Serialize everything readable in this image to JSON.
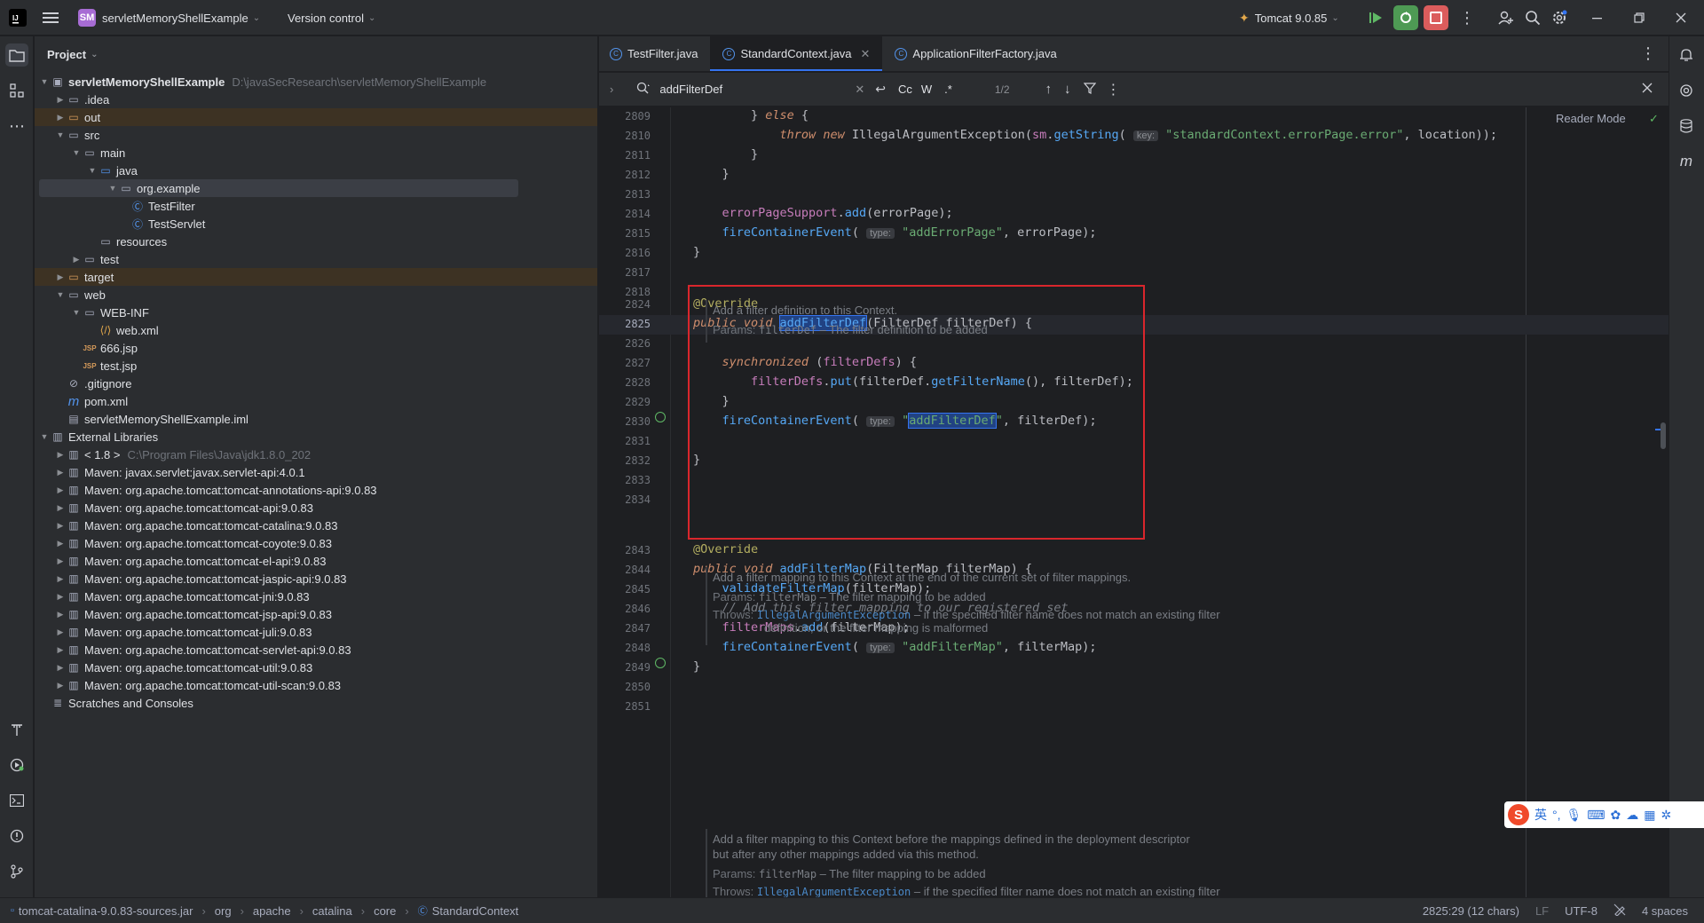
{
  "titlebar": {
    "project_badge": "SM",
    "project_name": "servletMemoryShellExample",
    "vcs": "Version control",
    "run_config": "Tomcat 9.0.85"
  },
  "project_panel": {
    "title": "Project",
    "tree": [
      {
        "label": "servletMemoryShellExample",
        "path": "D:\\javaSecResearch\\servletMemoryShellExample",
        "depth": 0,
        "arrow": "down",
        "icon": "module-folder-icon",
        "bold": true
      },
      {
        "label": ".idea",
        "depth": 1,
        "arrow": "right",
        "icon": "folder-icon"
      },
      {
        "label": "out",
        "depth": 1,
        "arrow": "right",
        "icon": "excluded-folder-icon",
        "excluded": true
      },
      {
        "label": "src",
        "depth": 1,
        "arrow": "down",
        "icon": "folder-icon"
      },
      {
        "label": "main",
        "depth": 2,
        "arrow": "down",
        "icon": "folder-icon"
      },
      {
        "label": "java",
        "depth": 3,
        "arrow": "down",
        "icon": "source-folder-icon"
      },
      {
        "label": "org.example",
        "depth": 4,
        "arrow": "down",
        "icon": "package-icon",
        "selected": true
      },
      {
        "label": "TestFilter",
        "depth": 5,
        "arrow": "",
        "icon": "class-icon"
      },
      {
        "label": "TestServlet",
        "depth": 5,
        "arrow": "",
        "icon": "class-icon"
      },
      {
        "label": "resources",
        "depth": 3,
        "arrow": "",
        "icon": "resources-folder-icon"
      },
      {
        "label": "test",
        "depth": 2,
        "arrow": "right",
        "icon": "folder-icon"
      },
      {
        "label": "target",
        "depth": 1,
        "arrow": "right",
        "icon": "excluded-folder-icon",
        "excluded": true
      },
      {
        "label": "web",
        "depth": 1,
        "arrow": "down",
        "icon": "folder-icon"
      },
      {
        "label": "WEB-INF",
        "depth": 2,
        "arrow": "down",
        "icon": "folder-icon"
      },
      {
        "label": "web.xml",
        "depth": 3,
        "arrow": "",
        "icon": "xml-file-icon"
      },
      {
        "label": "666.jsp",
        "depth": 2,
        "arrow": "",
        "icon": "jsp-file-icon"
      },
      {
        "label": "test.jsp",
        "depth": 2,
        "arrow": "",
        "icon": "jsp-file-icon"
      },
      {
        "label": ".gitignore",
        "depth": 1,
        "arrow": "",
        "icon": "gitignore-icon"
      },
      {
        "label": "pom.xml",
        "depth": 1,
        "arrow": "",
        "icon": "maven-icon"
      },
      {
        "label": "servletMemoryShellExample.iml",
        "depth": 1,
        "arrow": "",
        "icon": "iml-file-icon"
      },
      {
        "label": "External Libraries",
        "depth": 0,
        "arrow": "down",
        "icon": "library-icon"
      },
      {
        "label": "< 1.8 >",
        "path": "C:\\Program Files\\Java\\jdk1.8.0_202",
        "depth": 1,
        "arrow": "right",
        "icon": "library-icon"
      },
      {
        "label": "Maven: javax.servlet:javax.servlet-api:4.0.1",
        "depth": 1,
        "arrow": "right",
        "icon": "library-icon"
      },
      {
        "label": "Maven: org.apache.tomcat:tomcat-annotations-api:9.0.83",
        "depth": 1,
        "arrow": "right",
        "icon": "library-icon"
      },
      {
        "label": "Maven: org.apache.tomcat:tomcat-api:9.0.83",
        "depth": 1,
        "arrow": "right",
        "icon": "library-icon"
      },
      {
        "label": "Maven: org.apache.tomcat:tomcat-catalina:9.0.83",
        "depth": 1,
        "arrow": "right",
        "icon": "library-icon"
      },
      {
        "label": "Maven: org.apache.tomcat:tomcat-coyote:9.0.83",
        "depth": 1,
        "arrow": "right",
        "icon": "library-icon"
      },
      {
        "label": "Maven: org.apache.tomcat:tomcat-el-api:9.0.83",
        "depth": 1,
        "arrow": "right",
        "icon": "library-icon"
      },
      {
        "label": "Maven: org.apache.tomcat:tomcat-jaspic-api:9.0.83",
        "depth": 1,
        "arrow": "right",
        "icon": "library-icon"
      },
      {
        "label": "Maven: org.apache.tomcat:tomcat-jni:9.0.83",
        "depth": 1,
        "arrow": "right",
        "icon": "library-icon"
      },
      {
        "label": "Maven: org.apache.tomcat:tomcat-jsp-api:9.0.83",
        "depth": 1,
        "arrow": "right",
        "icon": "library-icon"
      },
      {
        "label": "Maven: org.apache.tomcat:tomcat-juli:9.0.83",
        "depth": 1,
        "arrow": "right",
        "icon": "library-icon"
      },
      {
        "label": "Maven: org.apache.tomcat:tomcat-servlet-api:9.0.83",
        "depth": 1,
        "arrow": "right",
        "icon": "library-icon"
      },
      {
        "label": "Maven: org.apache.tomcat:tomcat-util:9.0.83",
        "depth": 1,
        "arrow": "right",
        "icon": "library-icon"
      },
      {
        "label": "Maven: org.apache.tomcat:tomcat-util-scan:9.0.83",
        "depth": 1,
        "arrow": "right",
        "icon": "library-icon"
      },
      {
        "label": "Scratches and Consoles",
        "depth": 0,
        "arrow": "",
        "icon": "scratches-icon"
      }
    ]
  },
  "tabs": [
    {
      "label": "TestFilter.java",
      "active": false
    },
    {
      "label": "StandardContext.java",
      "active": true,
      "closable": true
    },
    {
      "label": "ApplicationFilterFactory.java",
      "active": false
    }
  ],
  "find": {
    "query": "addFilterDef",
    "match_case": "Cc",
    "words": "W",
    "regex": ".*",
    "count": "1/2"
  },
  "editor": {
    "reader_mode": "Reader Mode",
    "lines": [
      {
        "n": "2809",
        "code": [
          [
            "",
            "        } "
          ],
          [
            "kwi",
            "else"
          ],
          [
            "",
            " {"
          ]
        ]
      },
      {
        "n": "2810",
        "code": [
          [
            "",
            "            "
          ],
          [
            "kwi",
            "throw new "
          ],
          [
            "",
            "IllegalArgumentException("
          ],
          [
            "fld",
            "sm"
          ],
          [
            "",
            "."
          ],
          [
            "fn",
            "getString"
          ],
          [
            "",
            "( "
          ],
          [
            "hint",
            "key:"
          ],
          [
            "str",
            " \"standardContext.errorPage.error\""
          ],
          [
            "",
            ", location));"
          ]
        ]
      },
      {
        "n": "2811",
        "code": [
          [
            "",
            "        }"
          ]
        ]
      },
      {
        "n": "2812",
        "code": [
          [
            "",
            "    }"
          ]
        ]
      },
      {
        "n": "2813",
        "code": []
      },
      {
        "n": "2814",
        "code": [
          [
            "",
            "    "
          ],
          [
            "fld",
            "errorPageSupport"
          ],
          [
            "",
            "."
          ],
          [
            "fn",
            "add"
          ],
          [
            "",
            "(errorPage);"
          ]
        ]
      },
      {
        "n": "2815",
        "code": [
          [
            "",
            "    "
          ],
          [
            "fn",
            "fireContainerEvent"
          ],
          [
            "",
            "( "
          ],
          [
            "hint",
            "type:"
          ],
          [
            "str",
            " \"addErrorPage\""
          ],
          [
            "",
            ", errorPage);"
          ]
        ]
      },
      {
        "n": "2816",
        "code": [
          [
            "",
            "}"
          ]
        ]
      },
      {
        "n": "2817",
        "code": []
      },
      {
        "n": "2818",
        "code": []
      }
    ],
    "doc1": {
      "summary": "Add a filter definition to this Context.",
      "params_label": "Params:",
      "param": "filterDef",
      "param_desc": " – The filter definition to be added"
    },
    "lines2": [
      {
        "n": "2824",
        "code": [
          [
            "ann",
            "@Override"
          ]
        ]
      },
      {
        "n": "2825",
        "code": [
          [
            "kwi",
            "public void "
          ],
          [
            "hlfn",
            "addFilterDef"
          ],
          [
            "",
            "(FilterDef filterDef) {"
          ]
        ],
        "current": true
      },
      {
        "n": "2826",
        "code": []
      },
      {
        "n": "2827",
        "code": [
          [
            "",
            "    "
          ],
          [
            "kwi",
            "synchronized"
          ],
          [
            "",
            " ("
          ],
          [
            "fld",
            "filterDefs"
          ],
          [
            "",
            ") {"
          ]
        ]
      },
      {
        "n": "2828",
        "code": [
          [
            "",
            "        "
          ],
          [
            "fld",
            "filterDefs"
          ],
          [
            "",
            "."
          ],
          [
            "fn",
            "put"
          ],
          [
            "",
            "(filterDef."
          ],
          [
            "fn",
            "getFilterName"
          ],
          [
            "",
            "(), filterDef);"
          ]
        ]
      },
      {
        "n": "2829",
        "code": [
          [
            "",
            "    }"
          ]
        ]
      },
      {
        "n": "2830",
        "code": [
          [
            "",
            "    "
          ],
          [
            "fn",
            "fireContainerEvent"
          ],
          [
            "",
            "( "
          ],
          [
            "hint",
            "type:"
          ],
          [
            "str",
            " \""
          ],
          [
            "hlstr",
            "addFilterDef"
          ],
          [
            "str",
            "\""
          ],
          [
            "",
            ", filterDef);"
          ]
        ]
      },
      {
        "n": "2831",
        "code": []
      },
      {
        "n": "2832",
        "code": [
          [
            "",
            "}"
          ]
        ]
      },
      {
        "n": "2833",
        "code": []
      },
      {
        "n": "2834",
        "code": []
      }
    ],
    "doc2": {
      "summary": "Add a filter mapping to this Context at the end of the current set of filter mappings.",
      "params_label": "Params:",
      "param": "filterMap",
      "param_desc": " – The filter mapping to be added",
      "throws_label": "Throws:",
      "throws": "IllegalArgumentException",
      "throws_desc1": " – if the specified filter name does not match an existing filter",
      "throws_desc2": "definition, or the filter mapping is malformed"
    },
    "lines3": [
      {
        "n": "2843",
        "code": [
          [
            "ann",
            "@Override"
          ]
        ]
      },
      {
        "n": "2844",
        "code": [
          [
            "kwi",
            "public void "
          ],
          [
            "fn",
            "addFilterMap"
          ],
          [
            "",
            "(FilterMap filterMap) {"
          ]
        ]
      },
      {
        "n": "2845",
        "code": [
          [
            "",
            "    "
          ],
          [
            "fn",
            "validateFilterMap"
          ],
          [
            "",
            "(filterMap);"
          ]
        ]
      },
      {
        "n": "2846",
        "code": [
          [
            "",
            "    "
          ],
          [
            "cmt",
            "// Add this filter mapping to our registered set"
          ]
        ]
      },
      {
        "n": "2847",
        "code": [
          [
            "",
            "    "
          ],
          [
            "fld",
            "filterMaps"
          ],
          [
            "",
            "."
          ],
          [
            "fn",
            "add"
          ],
          [
            "",
            "(filterMap);"
          ]
        ]
      },
      {
        "n": "2848",
        "code": [
          [
            "",
            "    "
          ],
          [
            "fn",
            "fireContainerEvent"
          ],
          [
            "",
            "( "
          ],
          [
            "hint",
            "type:"
          ],
          [
            "str",
            " \"addFilterMap\""
          ],
          [
            "",
            ", filterMap);"
          ]
        ]
      },
      {
        "n": "2849",
        "code": [
          [
            "",
            "}"
          ]
        ]
      },
      {
        "n": "2850",
        "code": []
      },
      {
        "n": "2851",
        "code": []
      }
    ],
    "doc3": {
      "summary1": "Add a filter mapping to this Context before the mappings defined in the deployment descriptor",
      "summary2": "but after any other mappings added via this method.",
      "params_label": "Params:",
      "param": "filterMap",
      "param_desc": " – The filter mapping to be added",
      "throws_label": "Throws:",
      "throws": "IllegalArgumentException",
      "throws_desc1": " – if the specified filter name does not match an existing filter"
    }
  },
  "statusbar": {
    "crumbs": [
      "tomcat-catalina-9.0.83-sources.jar",
      "org",
      "apache",
      "catalina",
      "core",
      "StandardContext"
    ],
    "position": "2825:29 (12 chars)",
    "line_sep": "LF",
    "encoding": "UTF-8",
    "indent": "4 spaces"
  },
  "ime": {
    "lang": "英"
  },
  "colors": {
    "accent": "#3574f0",
    "highlight_box": "#d9262c",
    "run_green": "#4e9a54",
    "stop_red": "#db5c5c"
  }
}
